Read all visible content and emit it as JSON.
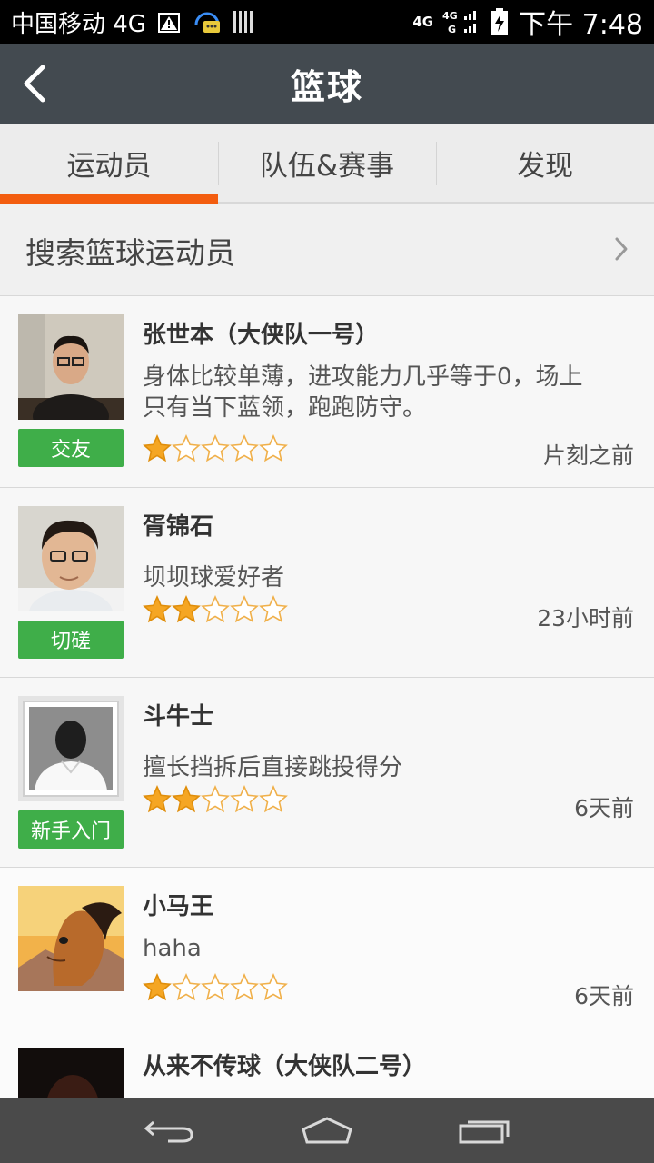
{
  "status_bar": {
    "carrier": "中国移动 4G",
    "network_top": "4G",
    "network_small": "4G",
    "network_g": "G",
    "time": "下午 7:48"
  },
  "app_bar": {
    "title": "篮球",
    "back_icon": "chevron-left-icon"
  },
  "tabs": [
    {
      "label": "运动员",
      "active": true
    },
    {
      "label": "队伍&赛事",
      "active": false
    },
    {
      "label": "发现",
      "active": false
    }
  ],
  "search": {
    "label": "搜索篮球运动员",
    "icon": "chevron-right-icon"
  },
  "players": [
    {
      "name": "张世本（大侠队一号）",
      "desc_line1": "身体比较单薄，进攻能力几乎等于0，场上",
      "desc_line2": "只有当下蓝领，跑跑防守。",
      "badge": "交友",
      "rating": 1,
      "rating_max": 5,
      "time": "片刻之前"
    },
    {
      "name": "胥锦石",
      "desc_line1": "坝坝球爱好者",
      "desc_line2": "",
      "badge": "切磋",
      "rating": 2,
      "rating_max": 5,
      "time": "23小时前"
    },
    {
      "name": "斗牛士",
      "desc_line1": "擅长挡拆后直接跳投得分",
      "desc_line2": "",
      "badge": "新手入门",
      "rating": 2,
      "rating_max": 5,
      "time": "6天前"
    },
    {
      "name": "小马王",
      "desc_line1": "haha",
      "desc_line2": "",
      "badge": "",
      "rating": 1,
      "rating_max": 5,
      "time": "6天前"
    },
    {
      "name": "从来不传球（大侠队二号）",
      "desc_line1": "",
      "desc_line2": "",
      "badge": "",
      "rating": 0,
      "rating_max": 5,
      "time": ""
    }
  ],
  "nav_bar": {
    "back_icon": "back-arrow-icon",
    "home_icon": "home-icon",
    "recents_icon": "recents-icon"
  },
  "colors": {
    "accent": "#f35d0f",
    "badge_green": "#3fae49",
    "star_fill": "#f5a623",
    "app_bar": "#434a50"
  }
}
